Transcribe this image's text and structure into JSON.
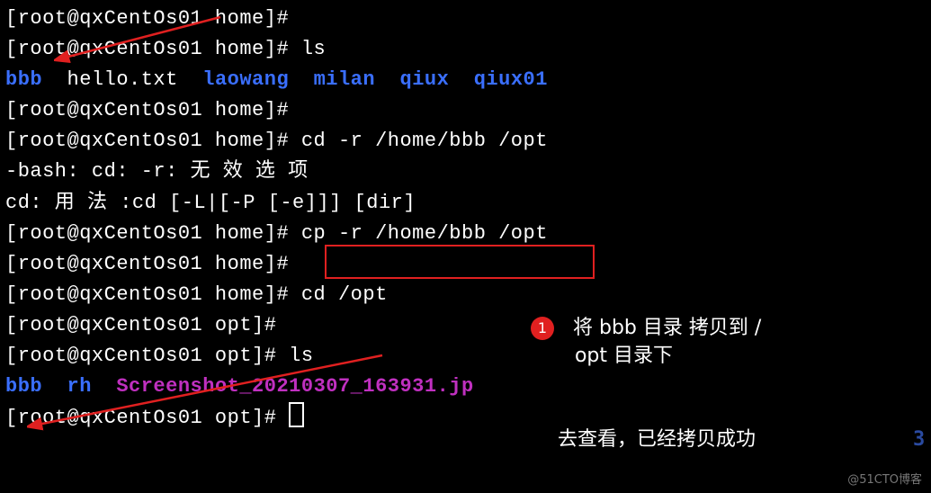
{
  "prompt": {
    "user": "root",
    "host": "qxCentOs01",
    "dir_home": "home",
    "dir_opt": "opt",
    "suffix": "#"
  },
  "lines": {
    "l0_prompt": "[root@qxCentOs01 home]#",
    "l1_prompt": "[root@qxCentOs01 home]# ",
    "l1_cmd": "ls",
    "ls_home": {
      "bbb": "bbb",
      "hello": "hello.txt",
      "laowang": "laowang",
      "milan": "milan",
      "qiux": "qiux",
      "qiux01": "qiux01"
    },
    "l3_prompt": "[root@qxCentOs01 home]#",
    "l4_prompt": "[root@qxCentOs01 home]# ",
    "l4_cmd": "cd -r /home/bbb /opt",
    "err1": "-bash: cd: -r: 无 效 选 项",
    "err2": "cd: 用 法 :cd [-L|[-P [-e]]] [dir]",
    "l7_prompt": "[root@qxCentOs01 home]# ",
    "l7_cmd": "cp -r /home/bbb /opt",
    "l8_prompt": "[root@qxCentOs01 home]#",
    "l9_prompt": "[root@qxCentOs01 home]# ",
    "l9_cmd": "cd /opt",
    "l10_prompt": "[root@qxCentOs01 opt]#",
    "l11_prompt": "[root@qxCentOs01 opt]# ",
    "l11_cmd": "ls",
    "ls_opt": {
      "bbb": "bbb",
      "rh": "rh",
      "screenshot": "Screenshot_20210307_163931.jp"
    },
    "l13_prompt": "[root@qxCentOs01 opt]# "
  },
  "annotations": {
    "badge1": "1",
    "note1_line1": "将 bbb 目录 拷贝到  /",
    "note1_line2": "opt 目录下",
    "note2": "去查看，已经拷贝成功",
    "trailing_3": "3"
  },
  "watermark": "@51CTO博客"
}
